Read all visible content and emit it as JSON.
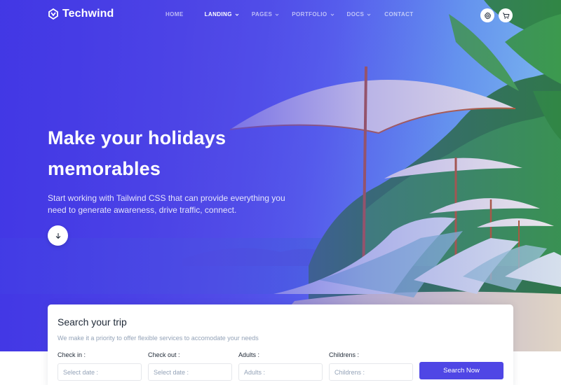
{
  "brand": {
    "name": "Techwind"
  },
  "nav": {
    "items": [
      {
        "label": "HOME",
        "active": false,
        "dropdown": false
      },
      {
        "label": "LANDING",
        "active": true,
        "dropdown": true
      },
      {
        "label": "PAGES",
        "active": false,
        "dropdown": true
      },
      {
        "label": "PORTFOLIO",
        "active": false,
        "dropdown": true
      },
      {
        "label": "DOCS",
        "active": false,
        "dropdown": true
      },
      {
        "label": "CONTACT",
        "active": false,
        "dropdown": false
      }
    ],
    "icons": [
      "gear-icon",
      "cart-icon"
    ]
  },
  "hero": {
    "title_line1": "Make your holidays",
    "title_line2": "memorables",
    "subtitle": "Start working with Tailwind CSS that can provide everything you need to generate awareness, drive traffic, connect.",
    "scroll_icon": "arrow-down-icon"
  },
  "search": {
    "title": "Search your trip",
    "description": "We make it a priority to offer flexible services to accomodate your needs",
    "fields": [
      {
        "label": "Check in :",
        "placeholder": "Select date :"
      },
      {
        "label": "Check out :",
        "placeholder": "Select date :"
      },
      {
        "label": "Adults :",
        "placeholder": "Adults :"
      },
      {
        "label": "Childrens :",
        "placeholder": "Childrens :"
      }
    ],
    "button_label": "Search Now"
  },
  "colors": {
    "accent": "#4f46e5",
    "hero_gradient_start": "#3b32d8",
    "text_dark": "#1f2937",
    "text_muted": "#94a3b8"
  }
}
